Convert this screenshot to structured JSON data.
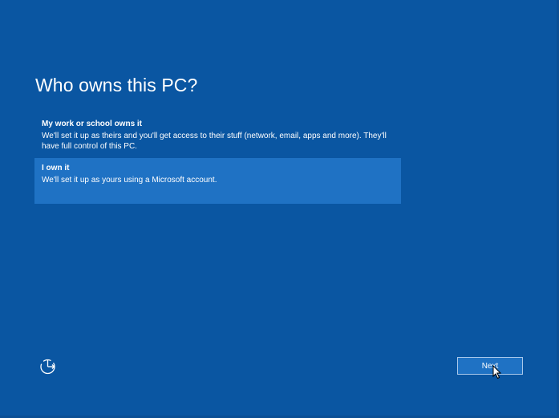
{
  "page": {
    "title": "Who owns this PC?"
  },
  "options": [
    {
      "title": "My work or school owns it",
      "description_line1": "We'll set it up as theirs and you'll get access to their stuff (network, email, apps and more). They'll",
      "description_line2": "have full control of this PC.",
      "selected": false
    },
    {
      "title": "I own it",
      "description_line1": "We'll set it up as yours using a Microsoft account.",
      "selected": true
    }
  ],
  "footer": {
    "ease_of_access_icon": "ease-of-access-icon",
    "next_label": "Next"
  },
  "colors": {
    "background": "#0a56a2",
    "selected_option": "#1f72c4",
    "button_border": "#a9c8ea",
    "text": "#ffffff"
  }
}
